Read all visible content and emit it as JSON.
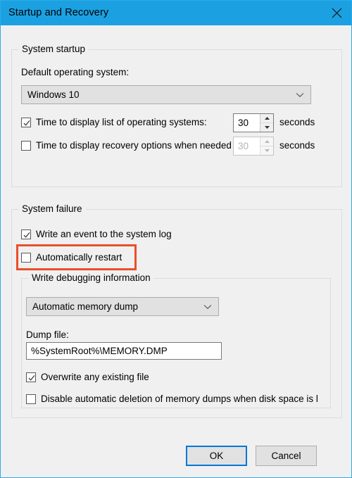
{
  "window": {
    "title": "Startup and Recovery",
    "close_icon": "close-icon",
    "titlebar_color": "#1ba1e2"
  },
  "system_startup": {
    "legend": "System startup",
    "default_os_label": "Default operating system:",
    "default_os_value": "Windows 10",
    "dropdown_icon": "chevron-down-icon",
    "timeout_os": {
      "label": "Time to display list of operating systems:",
      "checked": true,
      "value": "30",
      "unit": "seconds"
    },
    "timeout_recovery": {
      "label": "Time to display recovery options when needed",
      "checked": false,
      "value": "30",
      "unit": "seconds"
    }
  },
  "system_failure": {
    "legend": "System failure",
    "write_event": {
      "label": "Write an event to the system log",
      "checked": true
    },
    "auto_restart": {
      "label": "Automatically restart",
      "checked": false,
      "highlighted": true,
      "highlight_color": "#e8502a"
    },
    "debug_info": {
      "legend": "Write debugging information",
      "dump_type_value": "Automatic memory dump",
      "dropdown_icon": "chevron-down-icon",
      "dump_file_label": "Dump file:",
      "dump_file_value": "%SystemRoot%\\MEMORY.DMP",
      "overwrite": {
        "label": "Overwrite any existing file",
        "checked": true
      },
      "disable_deletion": {
        "label": "Disable automatic deletion of memory dumps when disk space is l",
        "checked": false
      }
    }
  },
  "footer": {
    "ok_label": "OK",
    "cancel_label": "Cancel",
    "default_button": "OK",
    "focus_color": "#0078d7"
  }
}
